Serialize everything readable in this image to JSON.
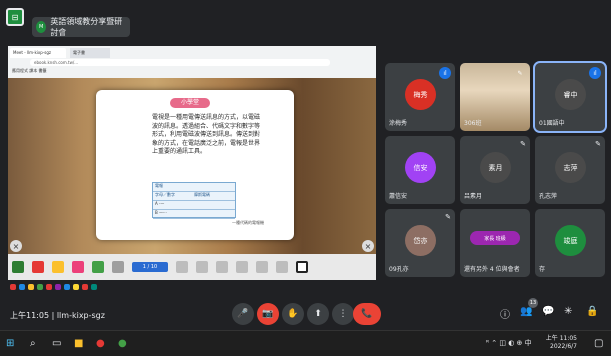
{
  "meeting": {
    "title": "英語領域教分享暨研討會",
    "code_label": "上午11:05 | llm-kixp-sgz"
  },
  "presentation": {
    "tab_title": "Meet - llm-kixp-sgz",
    "tab2_title": "電子書",
    "url": "ebook.knsh.com.tw/...",
    "bookmarks": "應用程式   課本   書籤",
    "card": {
      "heading": "小學堂",
      "body": "電視是一種用電傳送訊息的方式，以電磁波的訊息。透過組合、代碼文字和數字等形式，利用電磁波傳送到訊息。傳送到對象的方式，在電話廣泛之前，電報是世界上重要的通訊工具。",
      "table_title": "電報",
      "table_headers": [
        "字母／數字",
        "摩斯電碼"
      ],
      "table_rows": [
        "A  ·—",
        "B  —···"
      ],
      "note": "一種代碼的電報機"
    },
    "page_indicator": "1 / 10"
  },
  "participants": [
    {
      "name": "涂梅秀",
      "initials": "梅秀",
      "color": "#d93025",
      "state": "speaking"
    },
    {
      "name": "306班",
      "initials": "",
      "color": "#c9b79a",
      "state": "muted-video"
    },
    {
      "name": "01國語中",
      "initials": "睿中",
      "color": "#3c4043",
      "state": "active"
    },
    {
      "name": "蕭信安",
      "initials": "信安",
      "color": "#a142f4",
      "state": "none"
    },
    {
      "name": "吕素月",
      "initials": "素月",
      "color": "#4a4a4a",
      "state": "muted"
    },
    {
      "name": "孔志萍",
      "initials": "志萍",
      "color": "#4a4a4a",
      "state": "muted"
    },
    {
      "name": "09孔亦",
      "initials": "岱亦",
      "color": "#8d6e63",
      "state": "muted"
    },
    {
      "name": "還有另外 4 位與會者",
      "initials": "家長 班級",
      "color": "#9c27b0",
      "state": "more"
    },
    {
      "name": "存",
      "initials": "竣庭",
      "color": "#1e8e3e",
      "state": "none"
    }
  ],
  "controls": {
    "mic": "🎤",
    "cam": "📷",
    "hand": "✋",
    "present": "⬆",
    "more": "⋮",
    "end": "📞"
  },
  "right_icons": {
    "info": "ⓘ",
    "people": "👥",
    "people_count": "13",
    "chat": "💬",
    "activities": "✳",
    "lock": "🔒"
  },
  "windows": {
    "time": "上午 11:05",
    "date": "2022/6/7"
  }
}
